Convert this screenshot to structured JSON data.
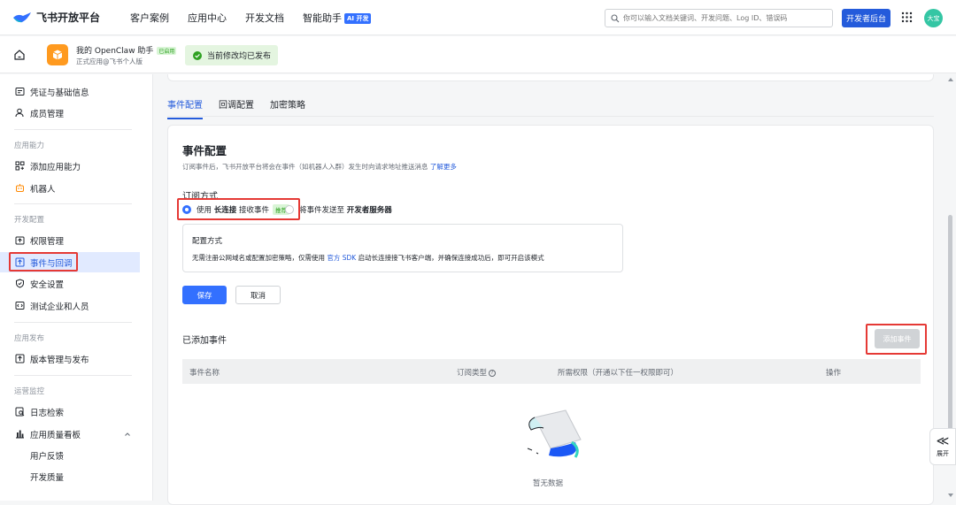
{
  "topbar": {
    "logo": "飞书开放平台",
    "nav": [
      "客户案例",
      "应用中心",
      "开发文档",
      "智能助手"
    ],
    "ai_badge": "AI 开发",
    "search_placeholder": "你可以输入文档关键词、开发问题、Log ID、错误码",
    "dev_console": "开发者后台",
    "avatar": "大宝"
  },
  "app": {
    "name": "我的 OpenClaw 助手",
    "tag": "已启用",
    "subtitle": "正式应用@飞书个人版",
    "status": "当前修改均已发布"
  },
  "sidebar": {
    "items": [
      {
        "label": "凭证与基础信息"
      },
      {
        "label": "成员管理"
      },
      {
        "label": "添加应用能力"
      },
      {
        "label": "机器人"
      },
      {
        "label": "权限管理"
      },
      {
        "label": "事件与回调"
      },
      {
        "label": "安全设置"
      },
      {
        "label": "测试企业和人员"
      },
      {
        "label": "版本管理与发布"
      },
      {
        "label": "日志检索"
      },
      {
        "label": "应用质量看板"
      },
      {
        "label": "用户反馈"
      },
      {
        "label": "开发质量"
      }
    ],
    "groups": [
      "应用能力",
      "开发配置",
      "应用发布",
      "运营监控"
    ]
  },
  "tabs": [
    "事件配置",
    "回调配置",
    "加密策略"
  ],
  "event_config": {
    "title": "事件配置",
    "desc": "订阅事件后，飞书开放平台将会在事件（如机器人入群）发生时向请求地址推送消息",
    "learn_more": "了解更多",
    "subscribe_label": "订阅方式",
    "option1_pre": "使用",
    "option1_bold": "长连接",
    "option1_post": "接收事件",
    "recommend": "推荐",
    "option2_pre": "将事件发送至",
    "option2_bold": "开发者服务器",
    "info_title": "配置方式",
    "info_text_pre": "无需注册公网域名或配置加密策略，仅需使用",
    "info_link": "官方 SDK",
    "info_text_post": "启动长连接接飞书客户端，并确保连接成功后，即可开启该模式",
    "save": "保存",
    "cancel": "取消"
  },
  "added_events": {
    "title": "已添加事件",
    "add_button": "添加事件",
    "columns": [
      "事件名称",
      "订阅类型",
      "所需权限（开通以下任一权限即可）",
      "操作"
    ],
    "empty": "暂无数据"
  },
  "expand": {
    "arrow": "≪",
    "label": "展开"
  }
}
